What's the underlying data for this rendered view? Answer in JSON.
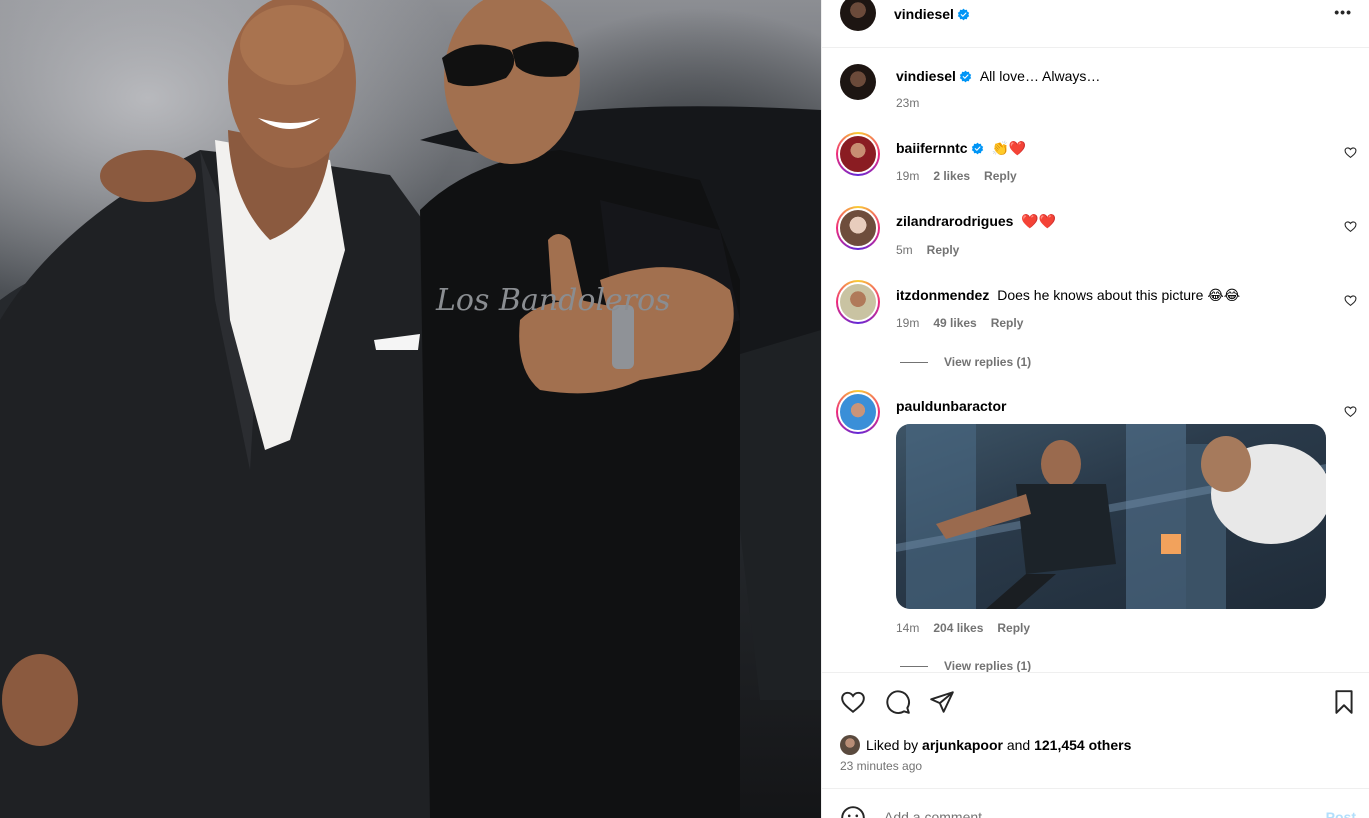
{
  "post": {
    "owner": "vindiesel",
    "caption": "All love… Always…",
    "caption_time": "23m",
    "more_label": "•••"
  },
  "comments": [
    {
      "user": "baiifernntc",
      "verified": true,
      "text": "👏❤️",
      "time": "19m",
      "likes": "2 likes",
      "reply": "Reply"
    },
    {
      "user": "zilandrarodrigues",
      "verified": false,
      "text": "❤️❤️",
      "time": "5m",
      "likes": "",
      "reply": "Reply"
    },
    {
      "user": "itzdonmendez",
      "verified": false,
      "text": "Does he knows about this picture 😂😂",
      "time": "19m",
      "likes": "49 likes",
      "reply": "Reply",
      "view_replies": "View replies (1)"
    },
    {
      "user": "pauldunbaractor",
      "verified": false,
      "text": "",
      "time": "14m",
      "likes": "204 likes",
      "reply": "Reply",
      "view_replies": "View replies (1)"
    }
  ],
  "likes": {
    "prefix": "Liked by",
    "user": "arjunkapoor",
    "and": "and",
    "others": "121,454 others",
    "posted": "23 minutes ago"
  },
  "add_comment": {
    "placeholder": "Add a comment…",
    "post_label": "Post"
  },
  "photo_shirt_text": "Los Bandoleros",
  "colors": {
    "verified_blue": "#0095f6",
    "meta_gray": "#737373",
    "post_disabled": "#b2dffc"
  }
}
